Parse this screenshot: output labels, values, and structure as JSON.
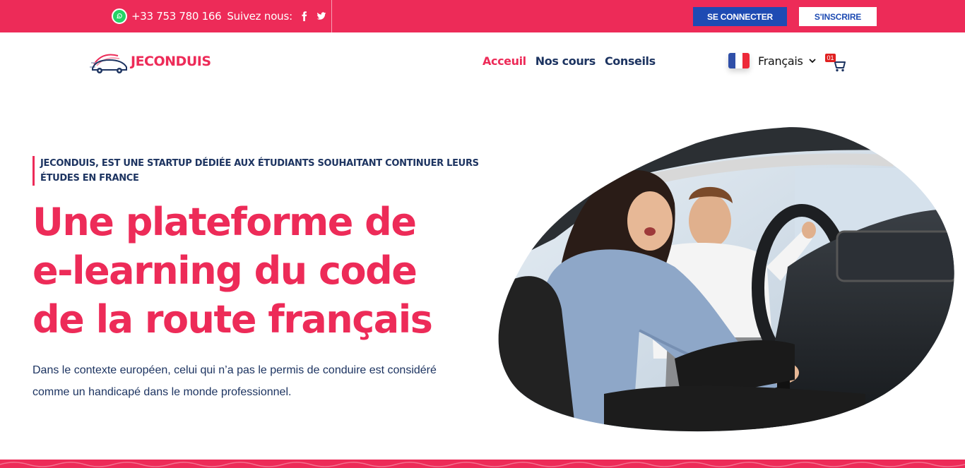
{
  "topbar": {
    "phone": "+33 753 780 166",
    "follow_label": "Suivez nous:",
    "login_label": "SE CONNECTER",
    "signup_label": "S'INSCRIRE",
    "bg_color": "#ed2b58"
  },
  "header": {
    "logo_text": "JECONDUIS",
    "nav": [
      {
        "label": "Acceuil",
        "active": true
      },
      {
        "label": "Nos cours",
        "active": false
      },
      {
        "label": "Conseils",
        "active": false
      }
    ],
    "language": "Français",
    "cart_count": "01"
  },
  "hero": {
    "tagline": "JECONDUIS, EST UNE STARTUP DÉDIÉE AUX ÉTUDIANTS SOUHAITANT CONTINUER LEURS ÉTUDES EN FRANCE",
    "headline_lines": [
      "Une plateforme de",
      "e-learning du code",
      "de la route français"
    ],
    "description": "Dans le contexte européen, celui qui n’a pas le permis de conduire est considéré comme un handicapé dans le monde professionnel."
  },
  "colors": {
    "accent": "#ed2b58",
    "navy": "#1d3461",
    "button_blue": "#1e4bb3"
  },
  "icons": [
    "whatsapp-icon",
    "facebook-icon",
    "twitter-icon",
    "france-flag-icon",
    "chevron-down-icon",
    "cart-icon"
  ]
}
